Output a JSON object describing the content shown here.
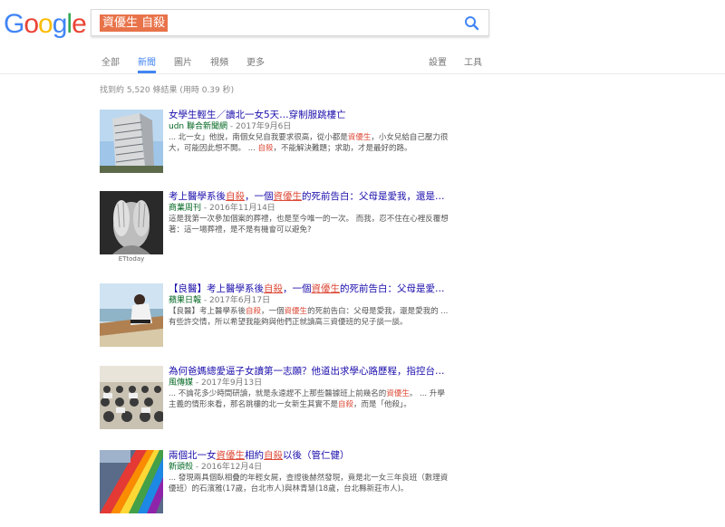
{
  "logo": {
    "text": [
      "G",
      "o",
      "o",
      "g",
      "l",
      "e"
    ]
  },
  "search": {
    "query": "資優生 自殺"
  },
  "tabs": [
    "全部",
    "新聞",
    "圖片",
    "視頻",
    "更多"
  ],
  "tools": {
    "settings": "設置",
    "tools": "工具"
  },
  "stats": "找到約 5,520 條結果  (用時 0.39 秒)",
  "results": [
    {
      "title_a": "女學生輕生／讀北一女5天…穿制服跳樓亡",
      "source": "udn 聯合新聞網",
      "date": " - 2017年9月6日",
      "snip_1": "... 北一女」他說，南個女兒自我要求很高，從小都是",
      "snip_hl_1": "資優生",
      "snip_2": "，小女兒給自己壓力很大，可能因此想不開。 ... ",
      "snip_hl_2": "自殺",
      "snip_3": "，不能解決難題；求助，才是最好的路。"
    },
    {
      "title_a": "考上醫學系後",
      "title_hl_1": "自殺",
      "title_b": "，一個",
      "title_hl_2": "資優生",
      "title_c": "的死前告白：父母是愛我，還是…",
      "source": "商業周刊",
      "date": " - 2016年11月14日",
      "snippet": "這是我第一次參加個案的葬禮，也是至今唯一的一次。 而我，忍不住在心裡反覆想著：這一場葬禮，是不是有機會可以避免?",
      "caption": "ETtoday"
    },
    {
      "title_a": "【良醫】考上醫學系後",
      "title_hl_1": "自殺",
      "title_b": "，一個",
      "title_hl_2": "資優生",
      "title_c": "的死前告白：父母是愛…",
      "source": "蘋果日報",
      "date": " - 2017年6月17日",
      "snip_1": "【良醫】考上醫學系後",
      "snip_hl_1": "自殺",
      "snip_2": "，一個",
      "snip_hl_2": "資優生",
      "snip_3": "的死前告白：父母是愛我，還是愛我的 ... 有些許交情，所以希望我能夠與他們正就讀高三資優班的兒子談一談。"
    },
    {
      "title_a": "為何爸媽總愛逼子女讀第一志願？他道出求學心路歷程，指控台…",
      "source": "風傳媒",
      "date": " - 2017年9月13日",
      "snip_1": "... 不論花多少時間研讀，就是永遠趕不上那些醫據班上前幾名的",
      "snip_hl_1": "資優生",
      "snip_2": "。 ... 升學主義的情形來看，那名跳樓的北一女新生其實不是",
      "snip_hl_2": "自殺",
      "snip_3": "，而是「他殺」。"
    },
    {
      "title_a": "兩個北一女",
      "title_hl_1": "資優生",
      "title_b": "相約",
      "title_hl_2": "自殺",
      "title_c": "以後（管仁健）",
      "source": "新頭殼",
      "date": " - 2016年12月4日",
      "snippet": "... 發現兩具個臥相疊的年輕女屍，查證後赫然發現，竟是北一女三年良班（數理資優班）的石濱雅(17歲，台北市人)與林青慧(18歲，台北縣新莊市人)。"
    }
  ],
  "colors": {
    "link": "#1a0dab",
    "source": "#006621",
    "highlight": "#dd4b39",
    "accent": "#4285f4",
    "query_bg": "#e8734a"
  }
}
